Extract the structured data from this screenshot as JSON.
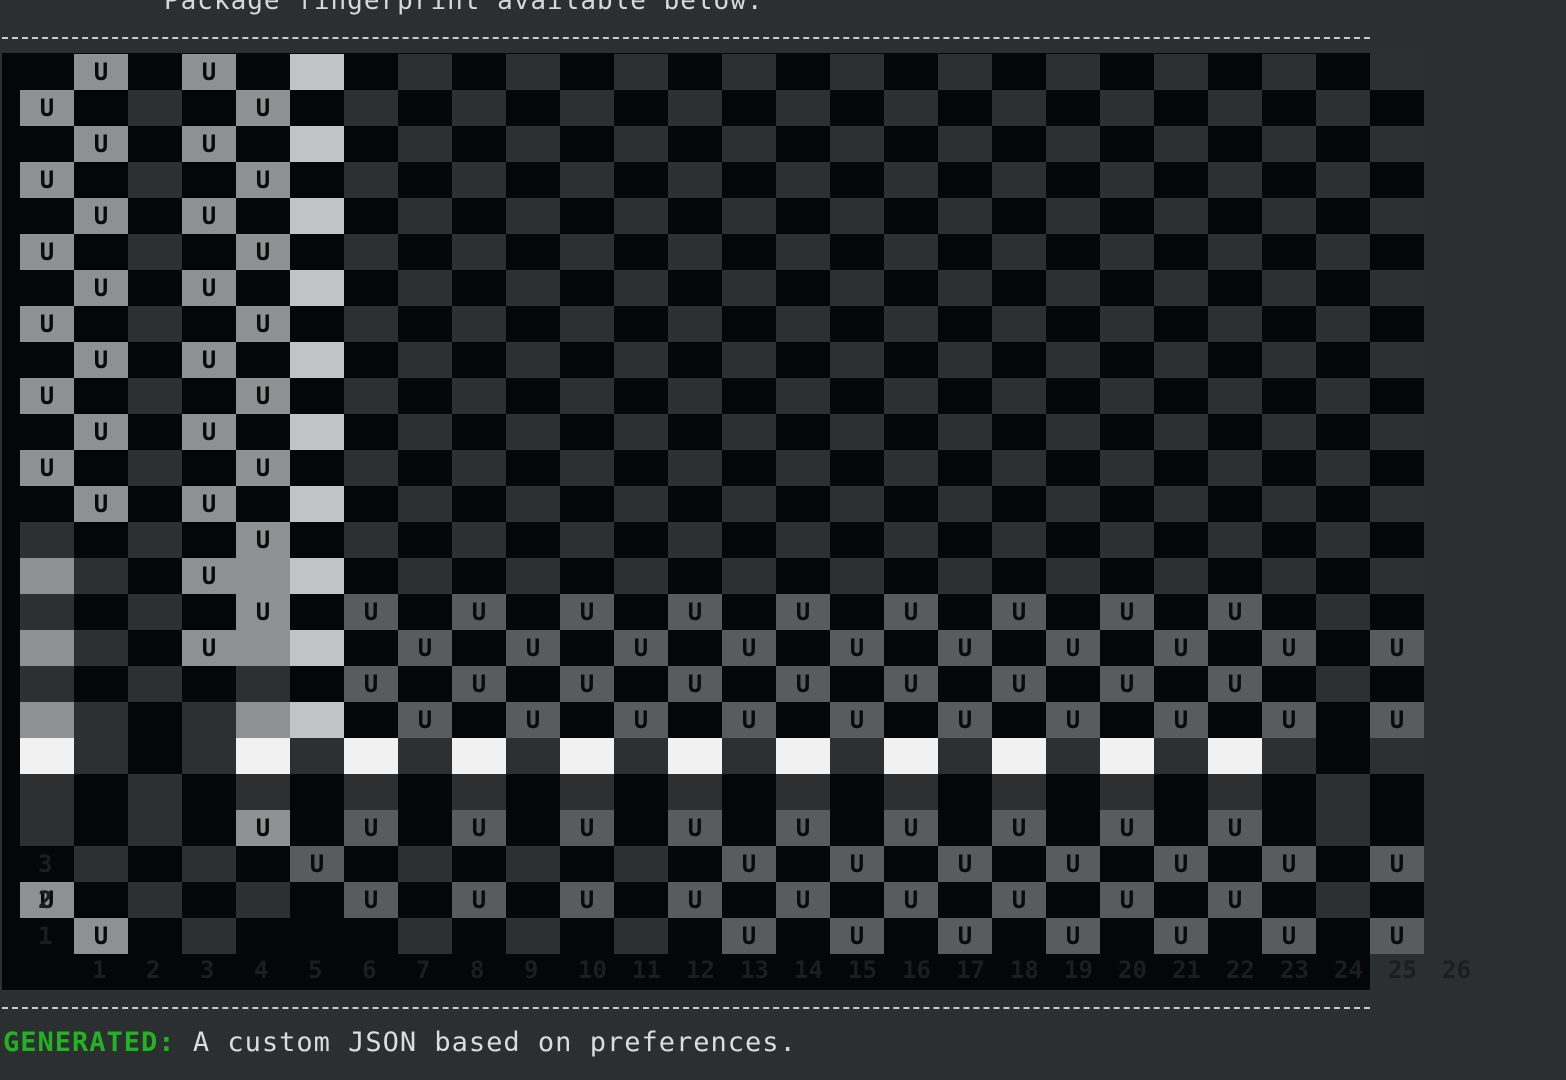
{
  "terminal": {
    "header_text": "Package fingerprint available below.",
    "footer_label": "GENERATED:",
    "footer_text": " A custom JSON based on preferences."
  },
  "board": {
    "columns": 26,
    "rows": 25,
    "cell_letter": "U",
    "column_labels": [
      "1",
      "2",
      "3",
      "4",
      "5",
      "6",
      "7",
      "8",
      "9",
      "10",
      "11",
      "12",
      "13",
      "14",
      "15",
      "16",
      "17",
      "18",
      "19",
      "20",
      "21",
      "22",
      "23",
      "24",
      "25",
      "26"
    ],
    "row_labels": [
      "3",
      "2",
      "1"
    ],
    "colors": {
      "black": "#050607",
      "dark": "#2e2f30",
      "dark_alt": "#3a3b3c",
      "mid": "#5a5b5c",
      "mid_alt": "#737475",
      "light": "#8f9091",
      "bright": "#c2c3c4",
      "white": "#f1f1f1"
    },
    "u_rows": [
      [
        1,
        3
      ],
      [
        0,
        4
      ],
      [
        1,
        3
      ],
      [
        0,
        4
      ],
      [
        1,
        3
      ],
      [
        0,
        4
      ],
      [
        1,
        3
      ],
      [
        0,
        4
      ],
      [
        1,
        3
      ],
      [
        0,
        4
      ],
      [
        1,
        3
      ],
      [
        0,
        4
      ],
      [
        1,
        3
      ],
      [
        4
      ],
      [
        3
      ],
      [
        4,
        6,
        8,
        10,
        12,
        14,
        16,
        18,
        20,
        22
      ],
      [
        3,
        7,
        9,
        11,
        13,
        15,
        17,
        19,
        21,
        23,
        25
      ],
      [
        6,
        8,
        10,
        12,
        14,
        16,
        18,
        20,
        22
      ],
      [
        7,
        9,
        11,
        13,
        15,
        17,
        19,
        21,
        23,
        25
      ],
      [],
      [],
      [
        4,
        6,
        8,
        10,
        12,
        14,
        16,
        18,
        20,
        22
      ],
      [
        5,
        13,
        15,
        17,
        19,
        21,
        23,
        25
      ],
      [
        0,
        6,
        8,
        10,
        12,
        14,
        16,
        18,
        20,
        22
      ],
      [
        1,
        13,
        15,
        17,
        19,
        21,
        23,
        25
      ]
    ]
  }
}
